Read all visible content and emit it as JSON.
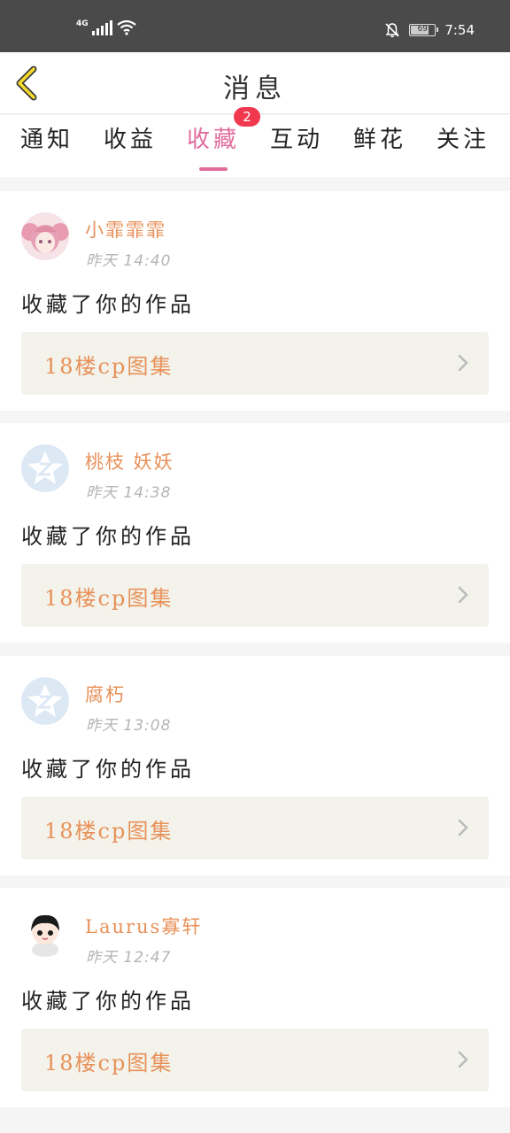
{
  "status_bar": {
    "network": "4G",
    "time": "7:54",
    "battery": "69"
  },
  "header": {
    "title": "消息"
  },
  "tabs": [
    {
      "label": "通知"
    },
    {
      "label": "收益"
    },
    {
      "label": "收藏",
      "badge": "2",
      "active": true
    },
    {
      "label": "互动"
    },
    {
      "label": "鲜花"
    },
    {
      "label": "关注"
    }
  ],
  "messages": [
    {
      "user": "小霏霏霏",
      "time": "昨天  14:40",
      "action": "收藏了你的作品",
      "work_title": "18楼cp图集",
      "avatar": "pink-hair-avatar"
    },
    {
      "user": "桃枝 妖妖",
      "time": "昨天  14:38",
      "action": "收藏了你的作品",
      "work_title": "18楼cp图集",
      "avatar": "default-avatar"
    },
    {
      "user": "腐朽",
      "time": "昨天  13:08",
      "action": "收藏了你的作品",
      "work_title": "18楼cp图集",
      "avatar": "default-avatar"
    },
    {
      "user": "Laurus寡轩",
      "time": "昨天  12:47",
      "action": "收藏了你的作品",
      "work_title": "18楼cp图集",
      "avatar": "chibi-avatar"
    }
  ],
  "colors": {
    "accent": "#e06c9c",
    "username": "#e8915a",
    "badge": "#f0394f",
    "work_bg": "#f3f3eb"
  }
}
